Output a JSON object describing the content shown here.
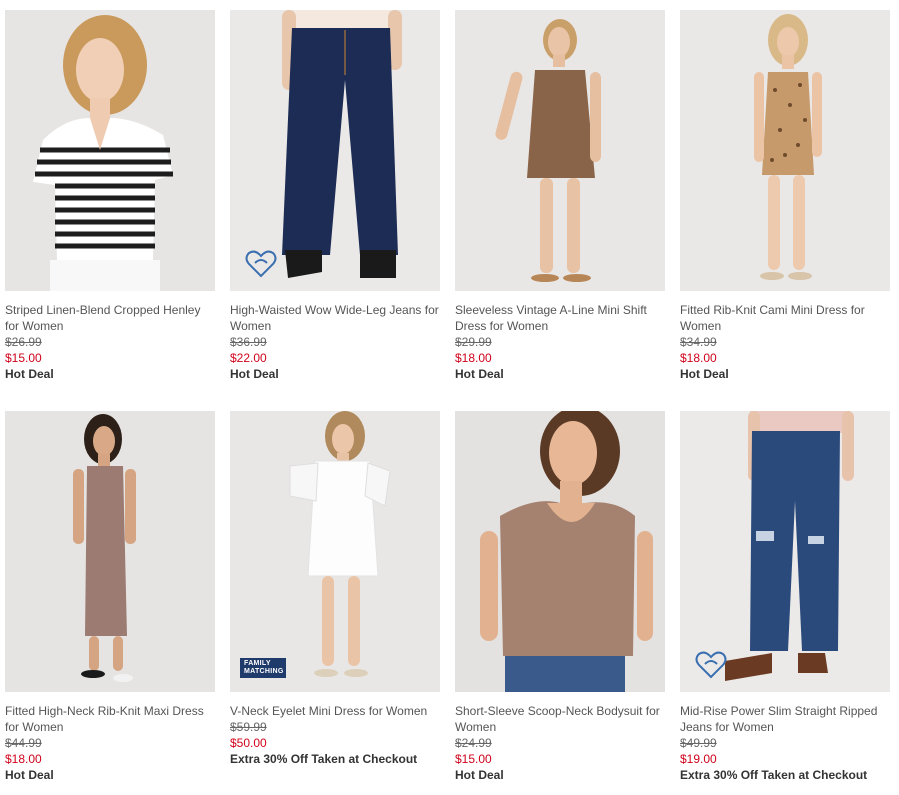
{
  "products": [
    {
      "name": "Striped Linen-Blend Cropped Henley for Women",
      "original_price": "$26.99",
      "sale_price": "$15.00",
      "promo": "Hot Deal",
      "badge": "",
      "bg": "#e7e5e3"
    },
    {
      "name": "High-Waisted Wow Wide-Leg Jeans for Women",
      "original_price": "$36.99",
      "sale_price": "$22.00",
      "promo": "Hot Deal",
      "badge": "heart-icon",
      "bg": "#ebe9e7"
    },
    {
      "name": "Sleeveless Vintage A-Line Mini Shift Dress for Women",
      "original_price": "$29.99",
      "sale_price": "$18.00",
      "promo": "Hot Deal",
      "badge": "",
      "bg": "#e9e7e5"
    },
    {
      "name": "Fitted Rib-Knit Cami Mini Dress for Women",
      "original_price": "$34.99",
      "sale_price": "$18.00",
      "promo": "Hot Deal",
      "badge": "",
      "bg": "#eae8e6"
    },
    {
      "name": "Fitted High-Neck Rib-Knit Maxi Dress for Women",
      "original_price": "$44.99",
      "sale_price": "$18.00",
      "promo": "Hot Deal",
      "badge": "",
      "bg": "#e6e4e2"
    },
    {
      "name": "V-Neck Eyelet Mini Dress for Women",
      "original_price": "$59.99",
      "sale_price": "$50.00",
      "promo": "Extra 30% Off Taken at Checkout",
      "badge": "FAMILY MATCHING",
      "bg": "#e9e7e5"
    },
    {
      "name": "Short-Sleeve Scoop-Neck Bodysuit for Women",
      "original_price": "$24.99",
      "sale_price": "$15.00",
      "promo": "Hot Deal",
      "badge": "",
      "bg": "#e4e2e0"
    },
    {
      "name": "Mid-Rise Power Slim Straight Ripped Jeans for Women",
      "original_price": "$49.99",
      "sale_price": "$19.00",
      "promo": "Extra 30% Off Taken at Checkout",
      "badge": "heart-icon",
      "bg": "#eceae8"
    }
  ]
}
